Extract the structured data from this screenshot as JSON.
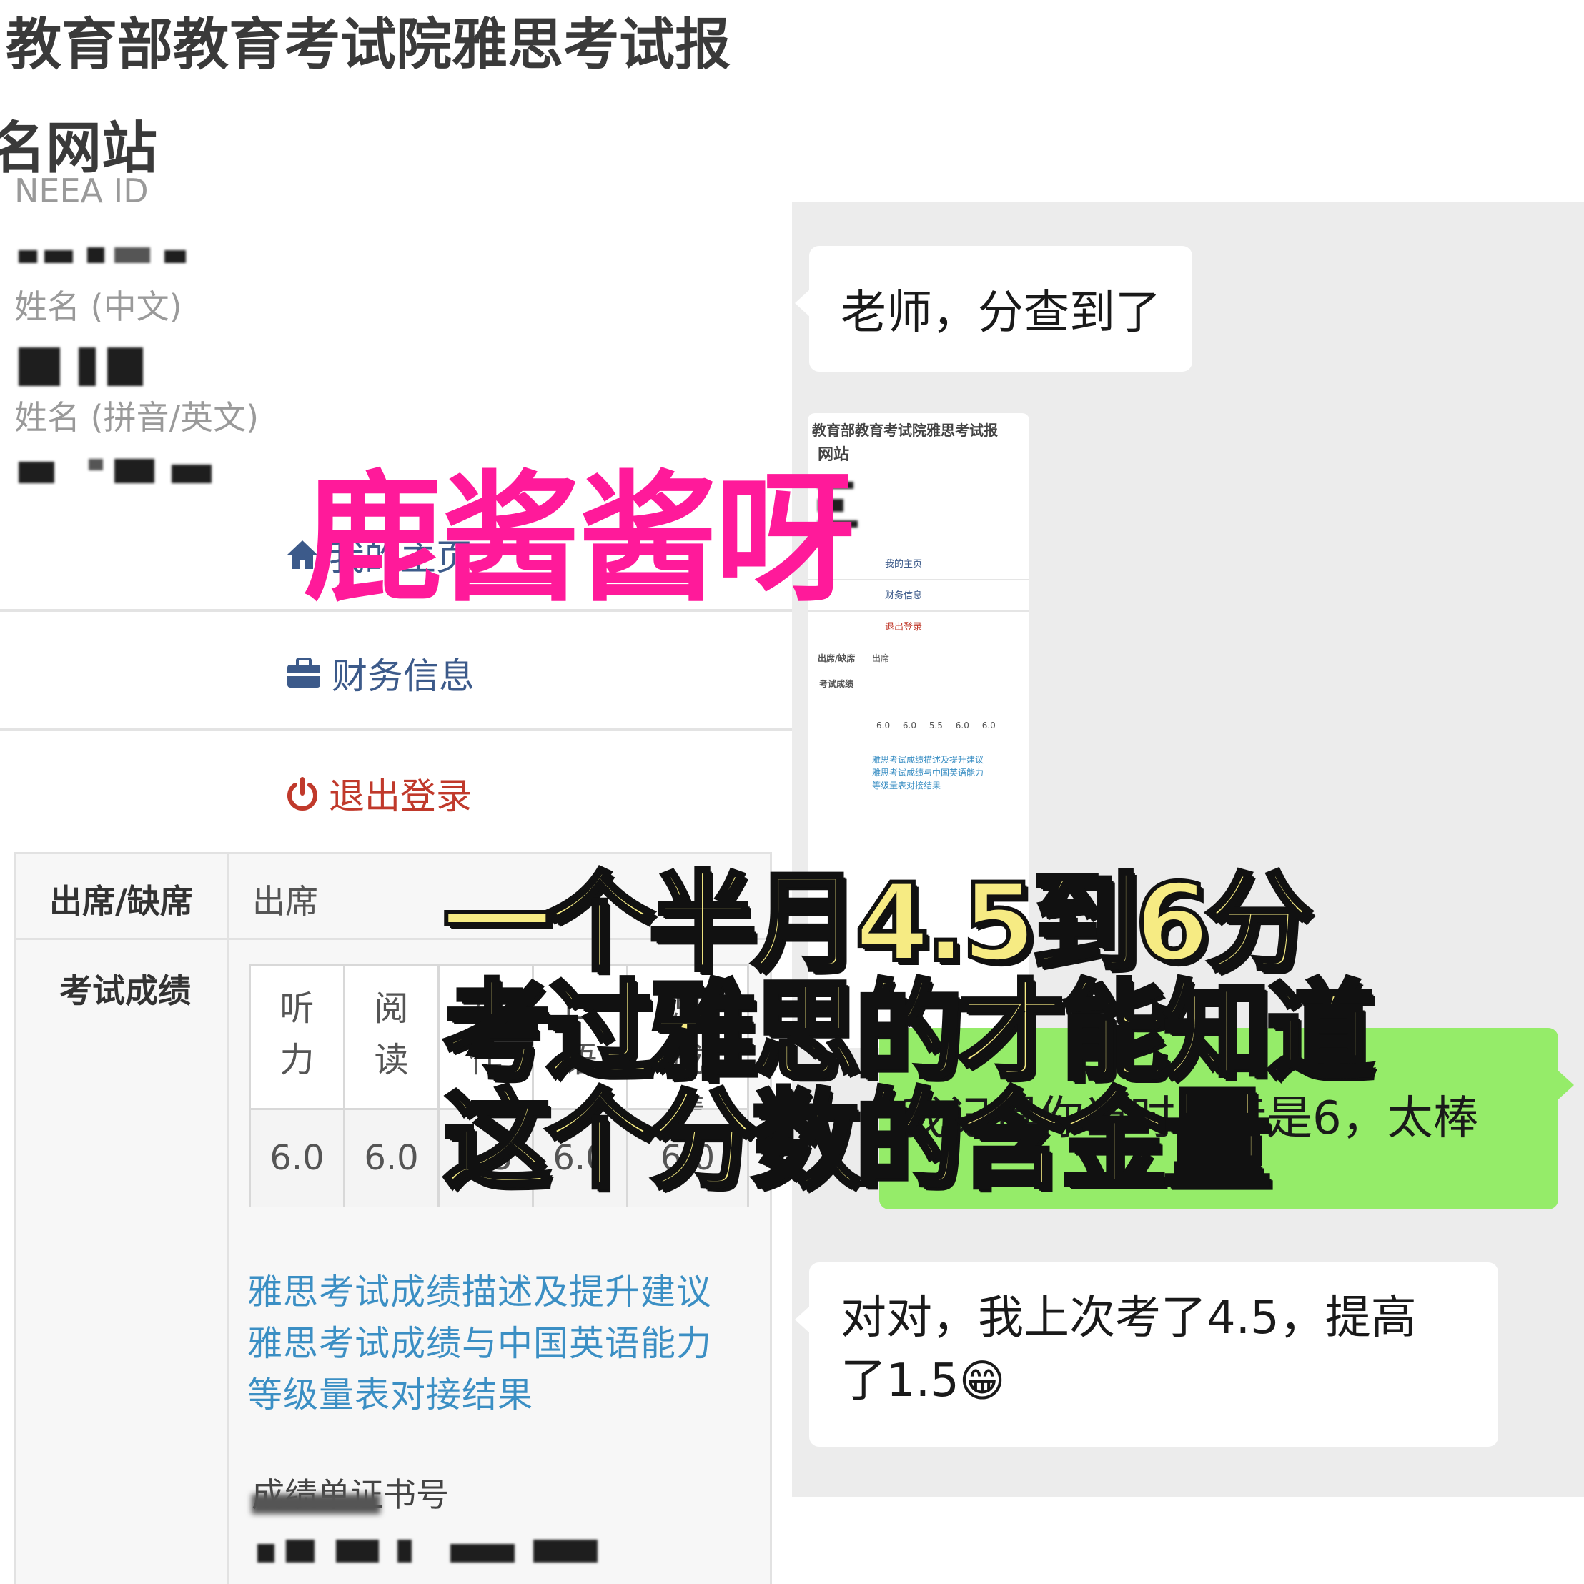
{
  "left_panel": {
    "site_title_line1": "教育部教育考试院雅思考试报",
    "site_title_line2": "名网站",
    "labels": {
      "neea_id": "NEEA ID",
      "name_cn": "姓名 (中文)",
      "name_en": "姓名 (拼音/英文)"
    },
    "nav": {
      "home": "我的主页",
      "finance": "财务信息",
      "logout": "退出登录"
    },
    "attendance_label": "出席/缺席",
    "attendance_value": "出席",
    "scores_label": "考试成绩",
    "score_headers": [
      "听力",
      "阅读",
      "写作",
      "口语",
      "总成绩"
    ],
    "score_values": [
      "6.0",
      "6.0",
      "5.5",
      "6.0",
      "6.0"
    ],
    "links": [
      "雅思考试成绩描述及提升建议",
      "雅思考试成绩与中国英语能力",
      "等级量表对接结果"
    ],
    "cert_label": "成绩单证书号"
  },
  "chat": {
    "msg1": "老师，分查到了",
    "thumb": {
      "title": "教育部教育考试院雅思考试报",
      "sub": "网站",
      "nav_home": "我的主页",
      "nav_finance": "财务信息",
      "nav_logout": "退出登录",
      "attendance_label": "出席/缺席",
      "attendance_value": "出席",
      "scores_label": "考试成绩",
      "link1": "雅思考试成绩描述及提升建议",
      "link2": "雅思考试成绩与中国英语能力",
      "link3": "等级量表对接结果"
    },
    "msg_green": "我记得你当时目标是6，太棒",
    "msg3_line1": "对对，我上次考了4.5，提高",
    "msg3_line2": "了1.5",
    "emoji": "😁"
  },
  "overlay": {
    "watermark": "鹿酱酱呀",
    "caption_line1": "一个半月4.5到6分",
    "caption_line2": "考过雅思的才能知道",
    "caption_line3": "这个分数的含金量"
  },
  "colors": {
    "watermark": "#ff1a9a",
    "caption_fill": "#f6eb83",
    "chat_bg": "#ececec",
    "green_bubble": "#95ec69",
    "link": "#3b8fc4"
  }
}
